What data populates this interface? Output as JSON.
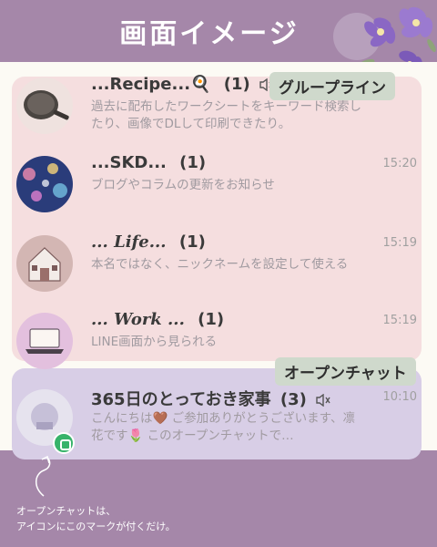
{
  "header": {
    "title": "画面イメージ"
  },
  "sections": {
    "group_tag": "グループライン",
    "open_tag": "オープンチャット"
  },
  "chats": [
    {
      "title": "...Recipe...🍳",
      "count": "(1)",
      "time": "",
      "preview": "過去に配布したワークシートをキーワード検索したり、画像でDLして印刷できたり。",
      "muted": true
    },
    {
      "title": "...SKD...",
      "count": "(1)",
      "time": "15:20",
      "preview": "ブログやコラムの更新をお知らせ",
      "muted": false
    },
    {
      "title": "... Life...",
      "count": "(1)",
      "time": "15:19",
      "preview": "本名ではなく、ニックネームを設定して使える",
      "muted": false
    },
    {
      "title": "... Work ...",
      "count": "(1)",
      "time": "15:19",
      "preview": "LINE画面から見られる",
      "muted": false
    },
    {
      "title": "365日のとっておき家事",
      "count": "(3)",
      "time": "10:10",
      "preview": "こんにちは🤎 ご参加ありがとうございます、凛花です🌷 このオープンチャットで…",
      "muted": true
    }
  ],
  "footer": {
    "note_line1": "オープンチャットは、",
    "note_line2": "アイコンにこのマークが付くだけ。"
  },
  "colors": {
    "background": "#a587a9",
    "group_highlight": "#f5dedf",
    "open_highlight": "#d8cee6",
    "tag_bg": "#cfd9cc",
    "open_badge": "#37b36a"
  },
  "icons": {
    "mute": "speaker-mute-icon",
    "open_chat_badge": "open-chat-badge-icon",
    "flowers": "flower-decoration"
  }
}
